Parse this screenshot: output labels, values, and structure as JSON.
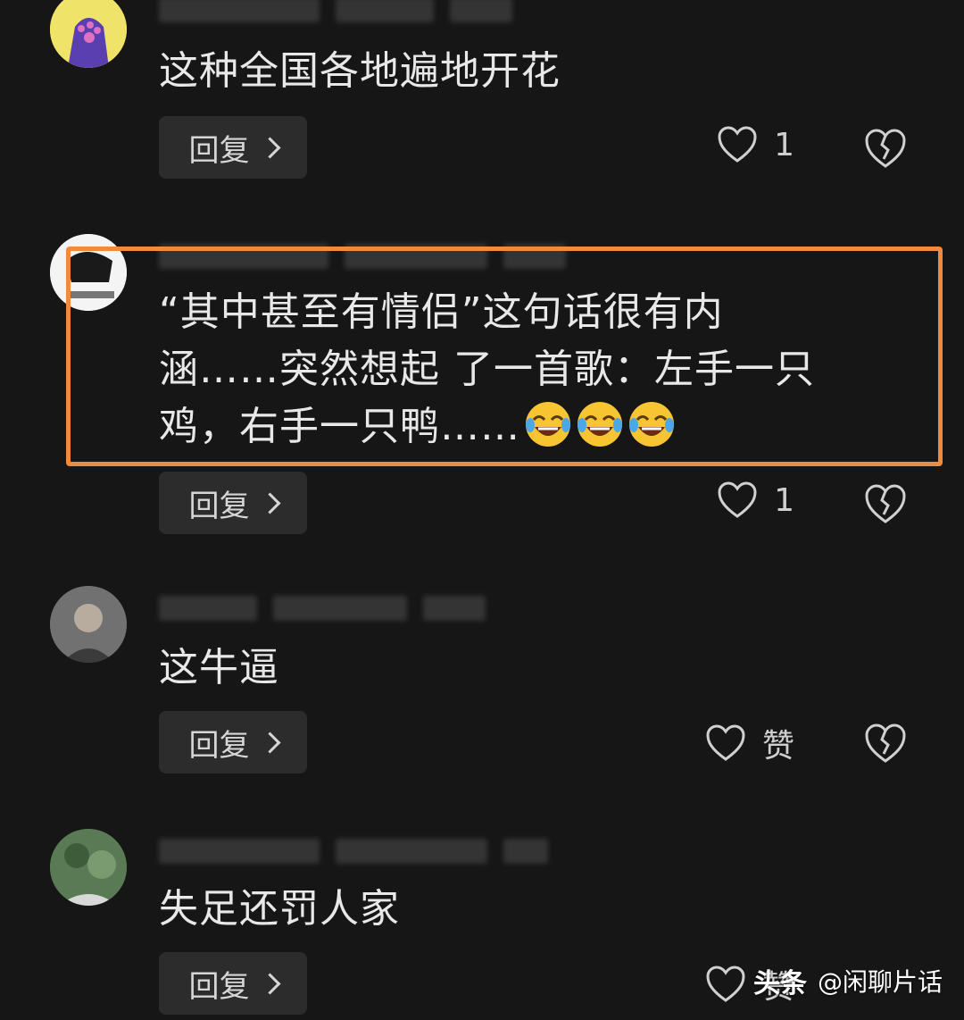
{
  "comments": [
    {
      "text": "这种全国各地遍地开花",
      "reply_label": "回复",
      "like_count": "1"
    },
    {
      "text_line1": "“其中甚至有情侣”这句话很有内",
      "text_line2": "涵……突然想起 了一首歌：左手一只",
      "text_line3": "鸡，右手一只鸭……",
      "reply_label": "回复",
      "like_count": "1"
    },
    {
      "text": "这牛逼",
      "reply_label": "回复",
      "like_label": "赞"
    },
    {
      "text": "失足还罚人家",
      "reply_label": "回复",
      "like_label": "赞"
    }
  ],
  "watermark": {
    "brand": "头条",
    "handle": "@闲聊片话"
  },
  "colors": {
    "background": "#161616",
    "highlight": "#f08a3c",
    "reply_bg": "#2c2c2c"
  },
  "icons": [
    "heart-outline-icon",
    "broken-heart-icon",
    "chevron-right-icon",
    "laughing-tears-emoji"
  ]
}
